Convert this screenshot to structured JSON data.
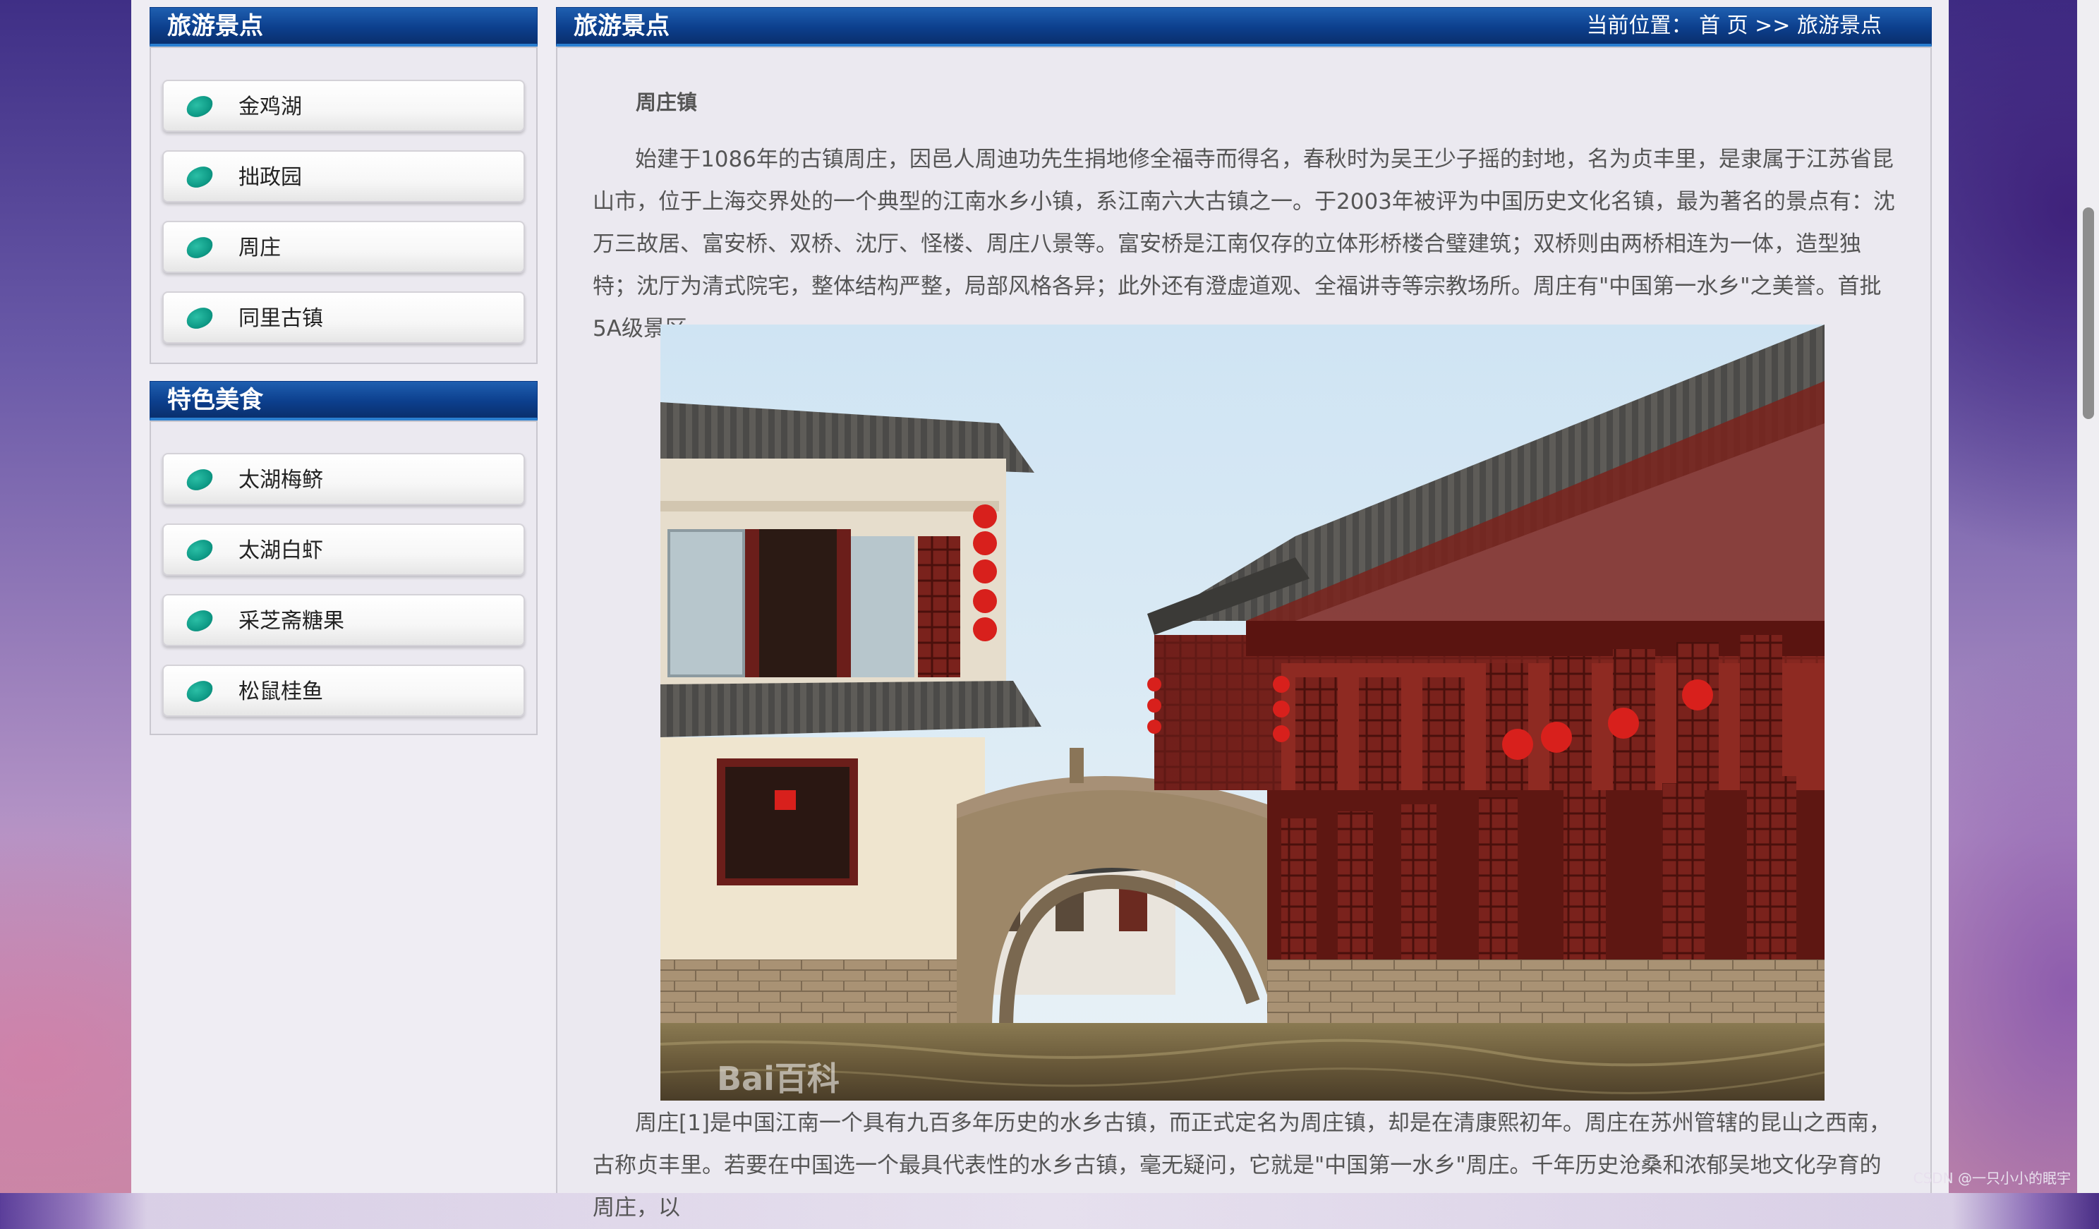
{
  "sidebar": {
    "sections": [
      {
        "title": "旅游景点",
        "items": [
          "金鸡湖",
          "拙政园",
          "周庄",
          "同里古镇"
        ]
      },
      {
        "title": "特色美食",
        "items": [
          "太湖梅鲚",
          "太湖白虾",
          "采芝斋糖果",
          "松鼠桂鱼"
        ]
      }
    ]
  },
  "main": {
    "header_title": "旅游景点",
    "breadcrumb": {
      "prefix": "当前位置：",
      "home": "首 页",
      "sep": ">>",
      "current": "旅游景点"
    },
    "article_title": "周庄镇",
    "paragraph1": "始建于1086年的古镇周庄，因邑人周迪功先生捐地修全福寺而得名，春秋时为吴王少子摇的封地，名为贞丰里，是隶属于江苏省昆山市，位于上海交界处的一个典型的江南水乡小镇，系江南六大古镇之一。于2003年被评为中国历史文化名镇，最为著名的景点有：沈万三故居、富安桥、双桥、沈厅、怪楼、周庄八景等。富安桥是江南仅存的立体形桥楼合璧建筑；双桥则由两桥相连为一体，造型独特；沈厅为清式院宅，整体结构严整，局部风格各异；此外还有澄虚道观、全福讲寺等宗教场所。周庄有\"中国第一水乡\"之美誉。首批5A级景区。",
    "photo_watermark": "Bai百科",
    "paragraph2": "周庄[1]是中国江南一个具有九百多年历史的水乡古镇，而正式定名为周庄镇，却是在清康熙初年。周庄在苏州管辖的昆山之西南，古称贞丰里。若要在中国选一个最具代表性的水乡古镇，毫无疑问，它就是\"中国第一水乡\"周庄。千年历史沧桑和浓郁吴地文化孕育的周庄，以"
  },
  "footer_watermark": "CSDN @一只小小的眠宇",
  "colors": {
    "header_blue": "#0c3f8d",
    "leaf_teal": "#0e9a86"
  },
  "icons": [
    "leaf-bullet-icon"
  ]
}
